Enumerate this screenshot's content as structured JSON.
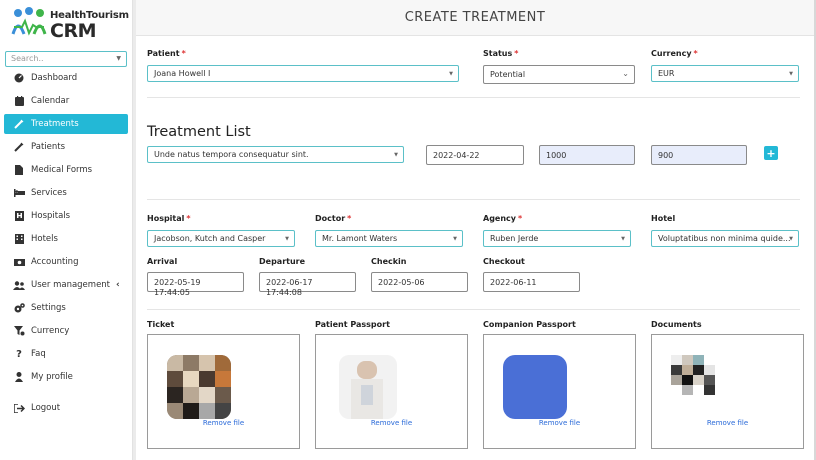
{
  "brand": {
    "top": "HealthTourism",
    "bottom": "CRM"
  },
  "search": {
    "placeholder": "Search.."
  },
  "sidebar": {
    "items": [
      {
        "label": "Dashboard",
        "icon": "dashboard-icon"
      },
      {
        "label": "Calendar",
        "icon": "calendar-icon"
      },
      {
        "label": "Treatments",
        "icon": "syringe-icon",
        "active": true
      },
      {
        "label": "Patients",
        "icon": "pencil-icon"
      },
      {
        "label": "Medical Forms",
        "icon": "file-icon"
      },
      {
        "label": "Services",
        "icon": "bed-icon"
      },
      {
        "label": "Hospitals",
        "icon": "hospital-icon"
      },
      {
        "label": "Hotels",
        "icon": "building-icon"
      },
      {
        "label": "Accounting",
        "icon": "money-icon"
      },
      {
        "label": "User management",
        "icon": "users-icon"
      },
      {
        "label": "Settings",
        "icon": "gears-icon"
      },
      {
        "label": "Currency",
        "icon": "filter-icon"
      },
      {
        "label": "Faq",
        "icon": "question-icon"
      },
      {
        "label": "My profile",
        "icon": "user-icon"
      },
      {
        "label": "Logout",
        "icon": "logout-icon"
      }
    ],
    "submenu_arrow": "‹"
  },
  "page": {
    "title": "CREATE TREATMENT"
  },
  "form": {
    "patient": {
      "label": "Patient",
      "value": "Joana Howell I"
    },
    "status": {
      "label": "Status",
      "value": "Potential"
    },
    "currency": {
      "label": "Currency",
      "value": "EUR"
    },
    "treatment_list": {
      "title": "Treatment List",
      "treatment": "Unde natus tempora consequatur sint.",
      "date": "2022-04-22",
      "price": "1000",
      "cost": "900",
      "add_label": "+"
    },
    "hospital": {
      "label": "Hospital",
      "value": "Jacobson, Kutch and Casper"
    },
    "doctor": {
      "label": "Doctor",
      "value": "Mr. Lamont Waters"
    },
    "agency": {
      "label": "Agency",
      "value": "Ruben Jerde"
    },
    "hotel": {
      "label": "Hotel",
      "value": "Voluptatibus non minima quide..."
    },
    "arrival": {
      "label": "Arrival",
      "value": "2022-05-19 17:44:05"
    },
    "departure": {
      "label": "Departure",
      "value": "2022-06-17 17:44:08"
    },
    "checkin": {
      "label": "Checkin",
      "value": "2022-05-06"
    },
    "checkout": {
      "label": "Checkout",
      "value": "2022-06-11"
    },
    "required_mark": "*"
  },
  "uploads": [
    {
      "label": "Ticket",
      "remove": "Remove file"
    },
    {
      "label": "Patient Passport",
      "remove": "Remove file"
    },
    {
      "label": "Companion Passport",
      "remove": "Remove file"
    },
    {
      "label": "Documents",
      "remove": "Remove file"
    }
  ],
  "colors": {
    "accent": "#23b8d6",
    "field_border": "#5bc0c8",
    "required": "#dd3333",
    "link": "#2a6ad8",
    "companion_tile": "#4a6fd6"
  }
}
